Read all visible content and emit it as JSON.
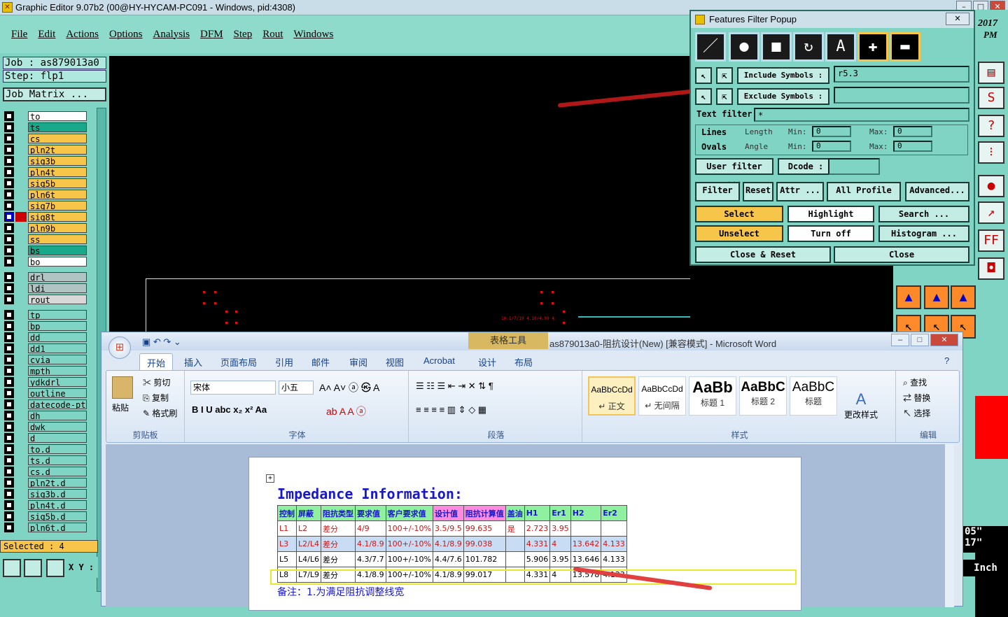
{
  "window": {
    "title": "Graphic Editor 9.07b2 (00@HY-HYCAM-PC091 - Windows, pid:4308)"
  },
  "menu": [
    "File",
    "Edit",
    "Actions",
    "Options",
    "Analysis",
    "DFM",
    "Step",
    "Rout",
    "Windows"
  ],
  "job": {
    "job_label": "Job : as879013a0",
    "step_label": "Step: flp1",
    "matrix_button": "Job Matrix ..."
  },
  "layers": [
    {
      "name": "to",
      "color": "#ffffff"
    },
    {
      "name": "ts",
      "color": "#1aa88a"
    },
    {
      "name": "cs",
      "color": "#f7c54a"
    },
    {
      "name": "pln2t",
      "color": "#f7c54a"
    },
    {
      "name": "sig3b",
      "color": "#f7c54a"
    },
    {
      "name": "pln4t",
      "color": "#f7c54a"
    },
    {
      "name": "sig5b",
      "color": "#f7c54a"
    },
    {
      "name": "pln6t",
      "color": "#f7c54a"
    },
    {
      "name": "sig7b",
      "color": "#f7c54a"
    },
    {
      "name": "sig8t",
      "color": "#f7c54a"
    },
    {
      "name": "pln9b",
      "color": "#f7c54a"
    },
    {
      "name": "ss",
      "color": "#f7c54a"
    },
    {
      "name": "bs",
      "color": "#1aa88a"
    },
    {
      "name": "bo",
      "color": "#ffffff"
    }
  ],
  "drill_layers": [
    {
      "name": "drl",
      "color": "#b0c4c4"
    },
    {
      "name": "ldi",
      "color": "#b0c4c4"
    },
    {
      "name": "rout",
      "color": "#d8d8d8"
    }
  ],
  "misc_layers": [
    "tp",
    "bp",
    "dd",
    "dd1",
    "cvia",
    "mpth",
    "ydkdrl",
    "outline",
    "datecode-pt",
    "dh",
    "dwk",
    "d",
    "to.d",
    "ts.d",
    "cs.d",
    "pln2t.d",
    "sig3b.d",
    "pln4t.d",
    "sig5b.d",
    "pln6t.d"
  ],
  "status": {
    "selected": "Selected : 4",
    "xy_label": "X Y :"
  },
  "canvas": {
    "marker_text": "10.1/7/19 4.10/4.99 4"
  },
  "filter_popup": {
    "title": "Features Filter Popup",
    "include_label": "Include Symbols :",
    "include_value": "r5.3",
    "exclude_label": "Exclude Symbols :",
    "exclude_value": "",
    "text_filter_label": "Text filter",
    "text_filter_value": "*",
    "lines_label": "Lines",
    "ovals_label": "Ovals",
    "length_label": "Length",
    "angle_label": "Angle",
    "min_label": "Min:",
    "max_label": "Max:",
    "min_value": "0",
    "max_value": "0",
    "user_filter": "User filter ...",
    "dcode_label": "Dcode :",
    "filter_btn": "Filter",
    "reset_btn": "Reset",
    "attr_btn": "Attr ...",
    "profile_btn": "All Profile",
    "advanced_btn": "Advanced...",
    "select_btn": "Select",
    "highlight_btn": "Highlight",
    "search_btn": "Search ...",
    "unselect_btn": "Unselect",
    "turnoff_btn": "Turn off",
    "histogram_btn": "Histogram ...",
    "close_reset_btn": "Close & Reset",
    "close_btn": "Close"
  },
  "right_panel": {
    "year": "2017",
    "ampm": "PM",
    "units": "Inch",
    "readout1": "05\"",
    "readout2": "17\""
  },
  "word": {
    "tool_label": "表格工具",
    "title": "as879013a0-阻抗设计(New) [兼容模式] - Microsoft Word",
    "tabs": [
      "开始",
      "插入",
      "页面布局",
      "引用",
      "邮件",
      "审阅",
      "视图",
      "Acrobat",
      "设计",
      "布局"
    ],
    "clipboard": {
      "paste": "粘贴",
      "cut": "剪切",
      "copy": "复制",
      "format_painter": "格式刷",
      "group": "剪贴板"
    },
    "font": {
      "name": "宋体",
      "size": "小五",
      "group": "字体"
    },
    "paragraph_group": "段落",
    "styles": [
      {
        "sample": "AaBbCcDd",
        "name": "↵ 正文"
      },
      {
        "sample": "AaBbCcDd",
        "name": "↵ 无间隔"
      },
      {
        "sample": "AaBb",
        "name": "标题 1"
      },
      {
        "sample": "AaBbC",
        "name": "标题 2"
      },
      {
        "sample": "AaBbC",
        "name": "标题"
      }
    ],
    "change_style": "更改样式",
    "styles_group": "样式",
    "editing": {
      "find": "查找",
      "replace": "替换",
      "select": "选择",
      "group": "编辑"
    },
    "doc": {
      "heading": "Impedance Information:",
      "columns": [
        "控制",
        "屏蔽",
        "阻抗类型",
        "要求值",
        "客户要求值",
        "设计值",
        "阻抗计算值",
        "盖油",
        "H1",
        "Er1",
        "H2",
        "Er2"
      ],
      "rows": [
        [
          "L1",
          "L2",
          "差分",
          "4/9",
          "100+/-10%",
          "3.5/9.5",
          "99.635",
          "是",
          "2.723",
          "3.95",
          "",
          ""
        ],
        [
          "L3",
          "L2/L4",
          "差分",
          "4.1/8.9",
          "100+/-10%",
          "4.1/8.9",
          "99.038",
          "",
          "4.331",
          "4",
          "13.642",
          "4.133"
        ],
        [
          "L5",
          "L4/L6",
          "差分",
          "4.3/7.7",
          "100+/-10%",
          "4.4/7.6",
          "101.782",
          "",
          "5.906",
          "3.95",
          "13.646",
          "4.133"
        ],
        [
          "L8",
          "L7/L9",
          "差分",
          "4.1/8.9",
          "100+/-10%",
          "4.1/8.9",
          "99.017",
          "",
          "4.331",
          "4",
          "13.578",
          "4.133"
        ]
      ],
      "note": "备注：1.为满足阻抗调整线宽"
    }
  }
}
